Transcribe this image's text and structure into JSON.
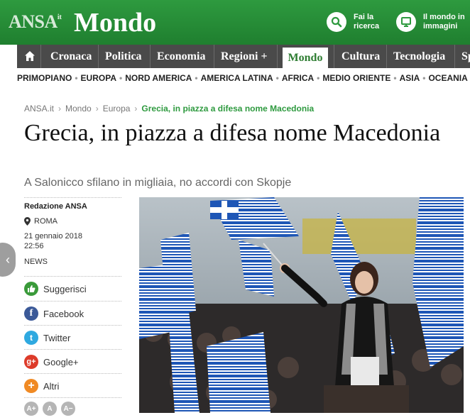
{
  "header": {
    "logo_brand": "ANSA",
    "logo_suffix": "it",
    "section_title": "Mondo",
    "search_label_1": "Fai la",
    "search_label_2": "ricerca",
    "world_label_1": "Il mondo in",
    "world_label_2": "immagini"
  },
  "nav": {
    "items": [
      "Cronaca",
      "Politica",
      "Economia",
      "Regioni +",
      "Mondo",
      "Cultura",
      "Tecnologia",
      "Sp"
    ],
    "active": "Mondo"
  },
  "subnav": [
    "PRIMOPIANO",
    "EUROPA",
    "NORD AMERICA",
    "AMERICA LATINA",
    "AFRICA",
    "MEDIO ORIENTE",
    "ASIA",
    "OCEANIA"
  ],
  "breadcrumb": {
    "items": [
      "ANSA.it",
      "Mondo",
      "Europa"
    ],
    "current": "Grecia, in piazza a difesa nome Macedonia"
  },
  "article": {
    "title": "Grecia, in piazza a difesa nome Macedonia",
    "subtitle": "A Salonicco sfilano in migliaia, no accordi con Skopje",
    "author": "Redazione ANSA",
    "location": "ROMA",
    "date": "21 gennaio 2018",
    "time": "22:56",
    "category": "NEWS"
  },
  "share": {
    "suggest": "Suggerisci",
    "facebook": "Facebook",
    "twitter": "Twitter",
    "google": "Google+",
    "more": "Altri"
  },
  "font_size": {
    "increase": "A+",
    "reset": "A",
    "decrease": "A−"
  },
  "colors": {
    "brand_green": "#2e9a3f",
    "nav_gray": "#4a4a4a",
    "flag_blue": "#1e56b6"
  }
}
